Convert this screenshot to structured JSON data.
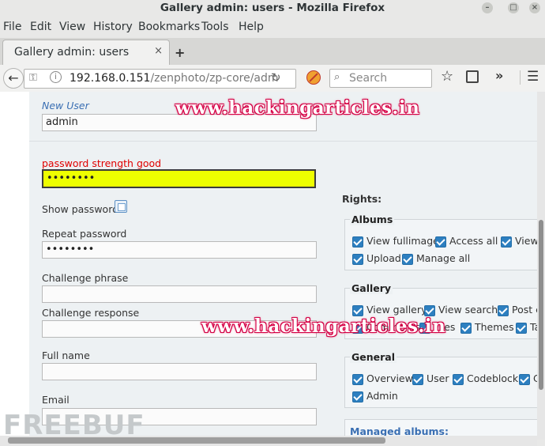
{
  "window": {
    "title": "Gallery admin: users - Mozilla Firefox"
  },
  "menubar": [
    "File",
    "Edit",
    "View",
    "History",
    "Bookmarks",
    "Tools",
    "Help"
  ],
  "tab": {
    "label": "Gallery admin: users",
    "close": "×",
    "new": "+"
  },
  "nav": {
    "url_host": "192.168.0.151",
    "url_path": "/zenphoto/zp-core/adm",
    "search_placeholder": "Search"
  },
  "form": {
    "new_user_label": "New User",
    "username_value": "admin",
    "password_strength": "password strength good",
    "password_value": "••••••••",
    "show_password_label": "Show password",
    "repeat_password_label": "Repeat password",
    "repeat_password_value": "••••••••",
    "challenge_phrase_label": "Challenge phrase",
    "challenge_response_label": "Challenge response",
    "full_name_label": "Full name",
    "email_label": "Email"
  },
  "rights": {
    "heading": "Rights:",
    "albums": {
      "title": "Albums",
      "items": [
        "View fullimage",
        "Access all",
        "View",
        "Upload",
        "Manage all"
      ]
    },
    "gallery": {
      "title": "Gallery",
      "items": [
        "View gallery",
        "View search",
        "Post c",
        "Comments",
        "Files",
        "Themes",
        "Ta"
      ]
    },
    "general": {
      "title": "General",
      "items": [
        "Overview",
        "User",
        "Codeblock",
        "C",
        "Admin"
      ]
    },
    "managed_albums": "Managed albums:"
  },
  "watermarks": {
    "site": "www.hackingarticles.in",
    "brand": "FREEBUF"
  },
  "colors": {
    "password_field": "#eeff00",
    "strength_text": "#e00000",
    "new_user_text": "#3a6fb3"
  }
}
